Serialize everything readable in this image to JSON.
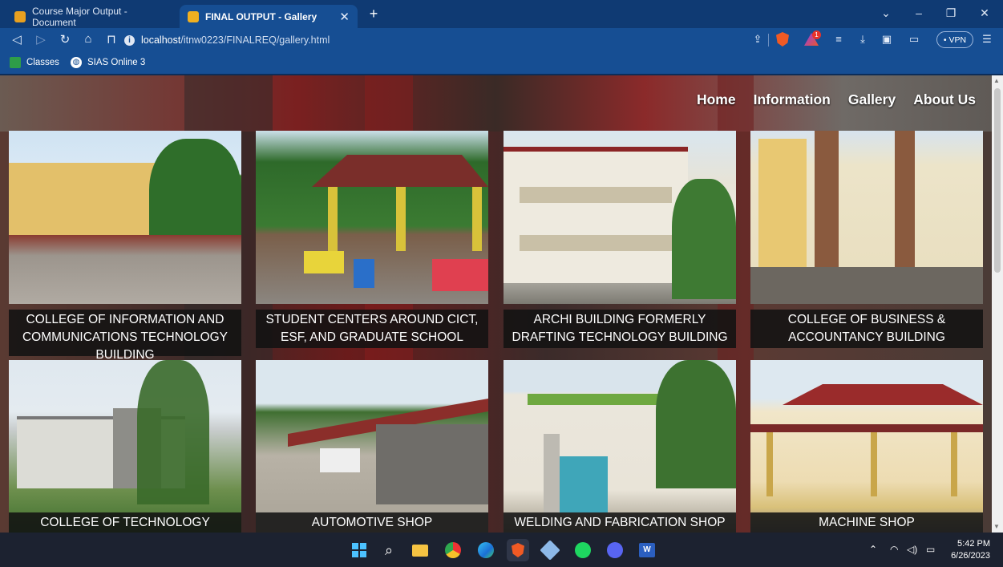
{
  "browser": {
    "tabs": [
      {
        "label": "Course Major Output - Document",
        "favicon_color": "#e8a020"
      },
      {
        "label": "FINAL OUTPUT - Gallery",
        "favicon_color": "#f0b020",
        "active": true
      }
    ],
    "url_host": "localhost",
    "url_path": "/itnw0223/FINALREQ/gallery.html",
    "vpn_label": "• VPN",
    "brave_badge": "1"
  },
  "bookmarks": [
    {
      "label": "Classes",
      "icon": "classes-icon"
    },
    {
      "label": "SIAS Online 3",
      "icon": "globe-icon"
    }
  ],
  "site_nav": {
    "home": "Home",
    "information": "Information",
    "gallery": "Gallery",
    "about": "About Us"
  },
  "gallery": [
    {
      "caption": "COLLEGE OF INFORMATION AND COMMUNICATIONS TECHNOLOGY BUILDING"
    },
    {
      "caption": "STUDENT CENTERS AROUND CICT, ESF, AND GRADUATE SCHOOL"
    },
    {
      "caption": "ARCHI BUILDING FORMERLY DRAFTING TECHNOLOGY BUILDING"
    },
    {
      "caption": "COLLEGE OF BUSINESS & ACCOUNTANCY BUILDING"
    },
    {
      "caption": "COLLEGE OF TECHNOLOGY BUILDING"
    },
    {
      "caption": "AUTOMOTIVE SHOP"
    },
    {
      "caption": "WELDING AND FABRICATION SHOP"
    },
    {
      "caption": "MACHINE SHOP"
    }
  ],
  "taskbar": {
    "time": "5:42 PM",
    "date": "6/26/2023"
  }
}
